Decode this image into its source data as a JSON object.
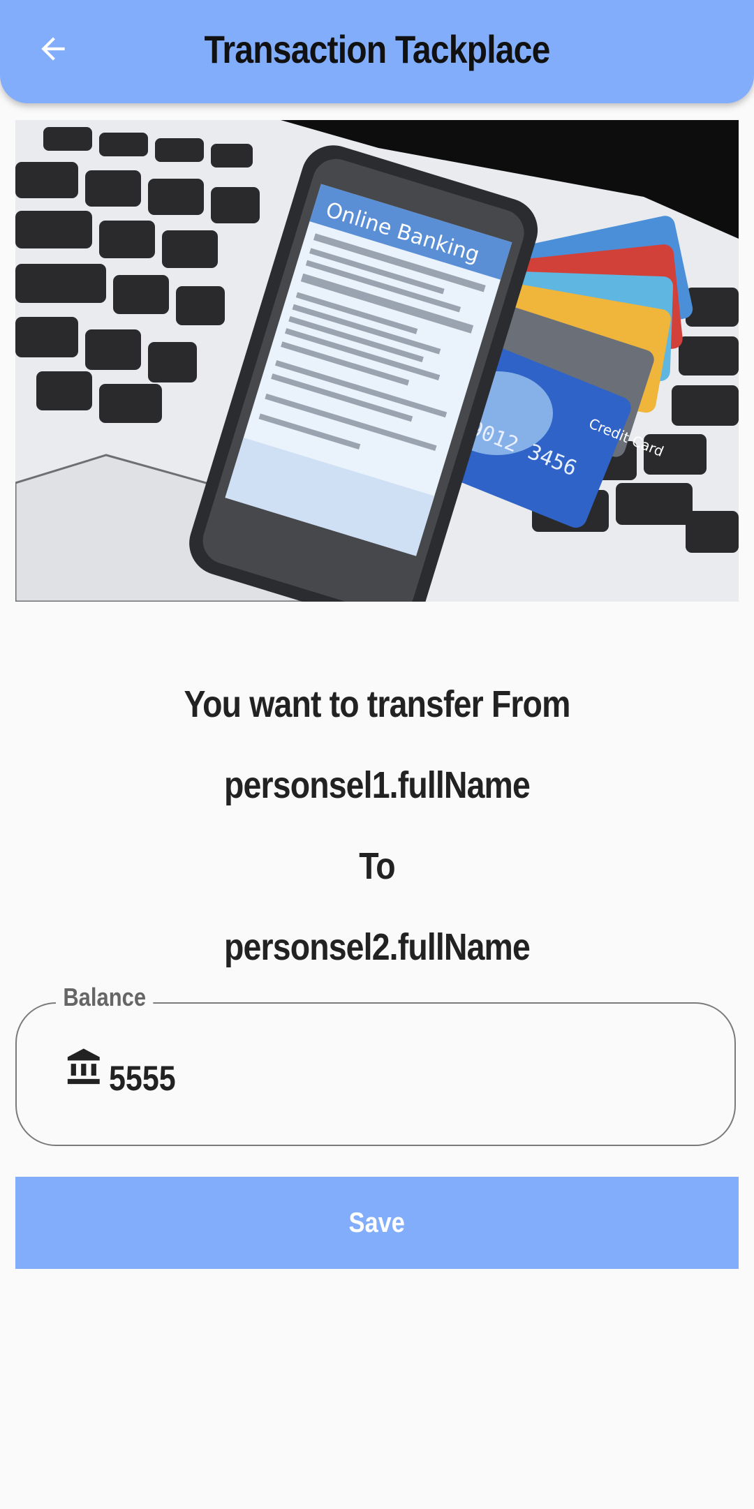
{
  "app_bar": {
    "title": "Transaction Tackplace",
    "back_icon": "arrow-back-icon",
    "color": "#82adfb"
  },
  "hero_image": {
    "screen_title": "Online Banking",
    "card_number": "78 9012 3456",
    "card_label": "Credit Card"
  },
  "message": {
    "line1": "You want to transfer From",
    "from_name": "personsel1.fullName",
    "line3": "To",
    "to_name": "personsel2.fullName"
  },
  "balance": {
    "label": "Balance",
    "icon": "bank-icon",
    "value": "5555"
  },
  "save_button": {
    "label": "Save",
    "color": "#82adfb"
  }
}
